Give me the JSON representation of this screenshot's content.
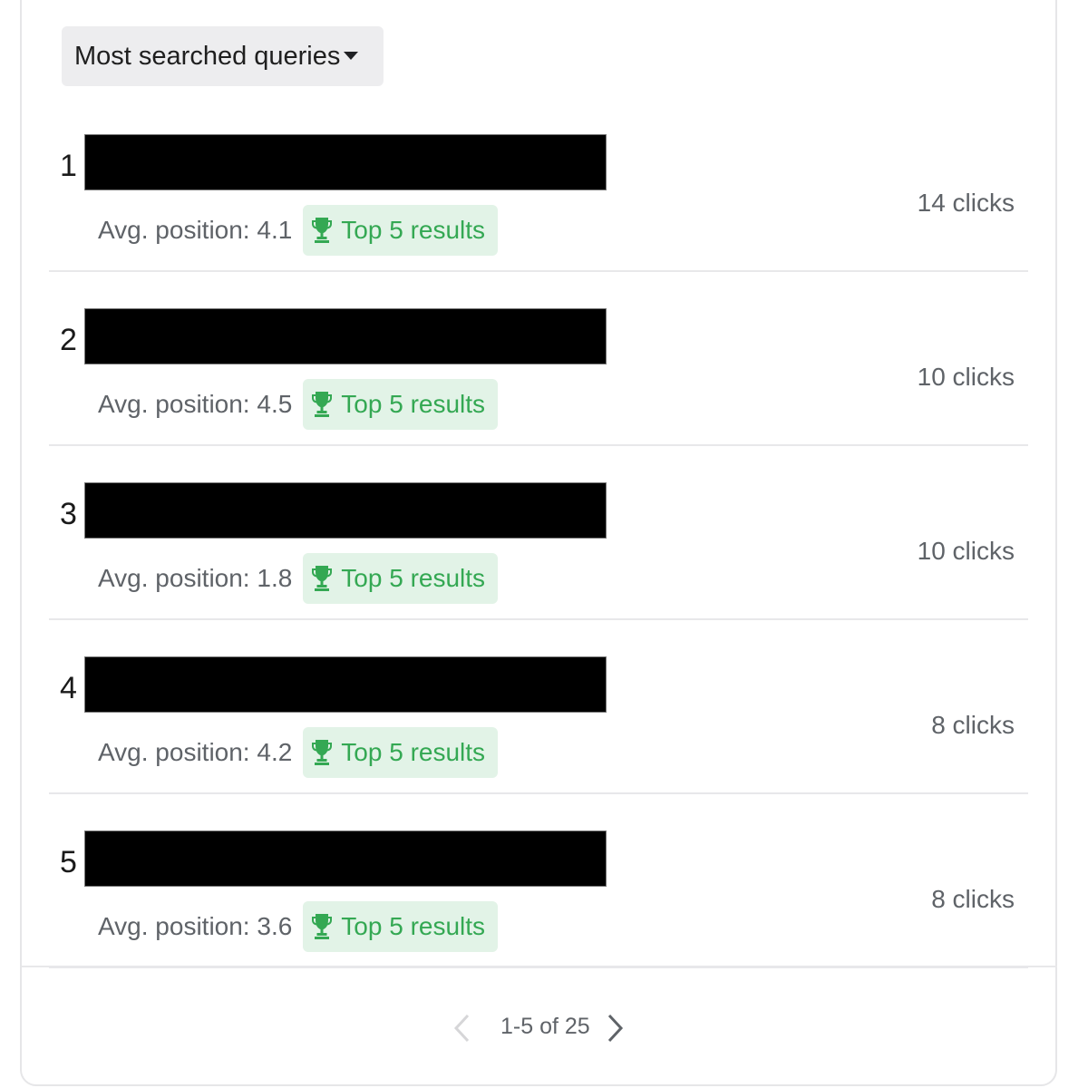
{
  "dropdown": {
    "label": "Most searched queries",
    "icon": "caret-down-icon"
  },
  "queries": [
    {
      "rank": "1",
      "query": "[redacted]",
      "avg_position": "Avg. position: 4.1",
      "badge": "Top 5 results",
      "clicks": "14 clicks"
    },
    {
      "rank": "2",
      "query": "[redacted]",
      "avg_position": "Avg. position: 4.5",
      "badge": "Top 5 results",
      "clicks": "10 clicks"
    },
    {
      "rank": "3",
      "query": "[redacted]",
      "avg_position": "Avg. position: 1.8",
      "badge": "Top 5 results",
      "clicks": "10 clicks"
    },
    {
      "rank": "4",
      "query": "[redacted]",
      "avg_position": "Avg. position: 4.2",
      "badge": "Top 5 results",
      "clicks": "8 clicks"
    },
    {
      "rank": "5",
      "query": "[redacted]",
      "avg_position": "Avg. position: 3.6",
      "badge": "Top 5 results",
      "clicks": "8 clicks"
    }
  ],
  "badge_icon": "trophy-icon",
  "colors": {
    "badge_text": "#34a853",
    "badge_bg": "#e2f3e7",
    "dropdown_bg": "#ededef"
  },
  "pagination": {
    "label": "1-5 of 25",
    "prev_icon": "chevron-left-icon",
    "next_icon": "chevron-right-icon",
    "prev_disabled": true
  }
}
